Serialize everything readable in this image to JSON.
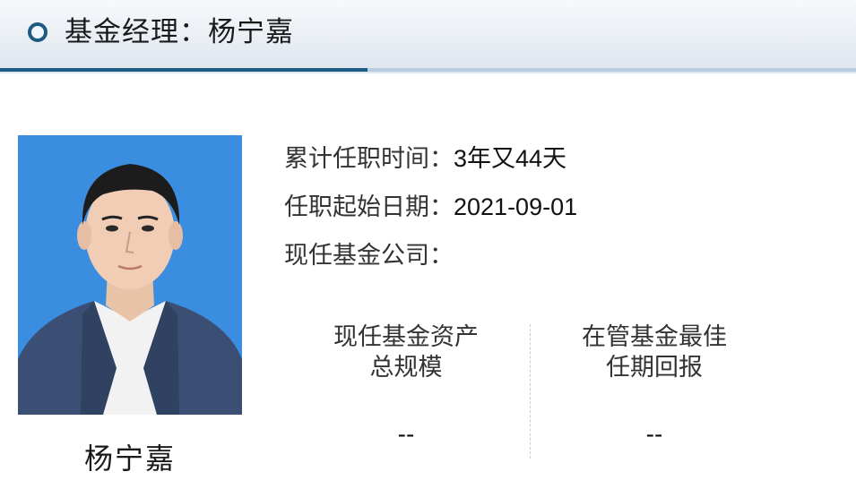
{
  "header": {
    "title": "基金经理：杨宁嘉"
  },
  "manager": {
    "name": "杨宁嘉",
    "photo_alt": "杨宁嘉"
  },
  "info": {
    "tenure_label": "累计任职时间：",
    "tenure_value": "3年又44天",
    "start_label": "任职起始日期：",
    "start_value": "2021-09-01",
    "company_label": "现任基金公司：",
    "company_value": ""
  },
  "stats": {
    "assets_label_line1": "现任基金资产",
    "assets_label_line2": "总规模",
    "assets_value": "--",
    "best_return_label_line1": "在管基金最佳",
    "best_return_label_line2": "任期回报",
    "best_return_value": "--"
  },
  "colors": {
    "accent": "#1e5a82",
    "photo_background": "#3b8de0"
  },
  "icons": {
    "header_marker": "ring-icon"
  }
}
